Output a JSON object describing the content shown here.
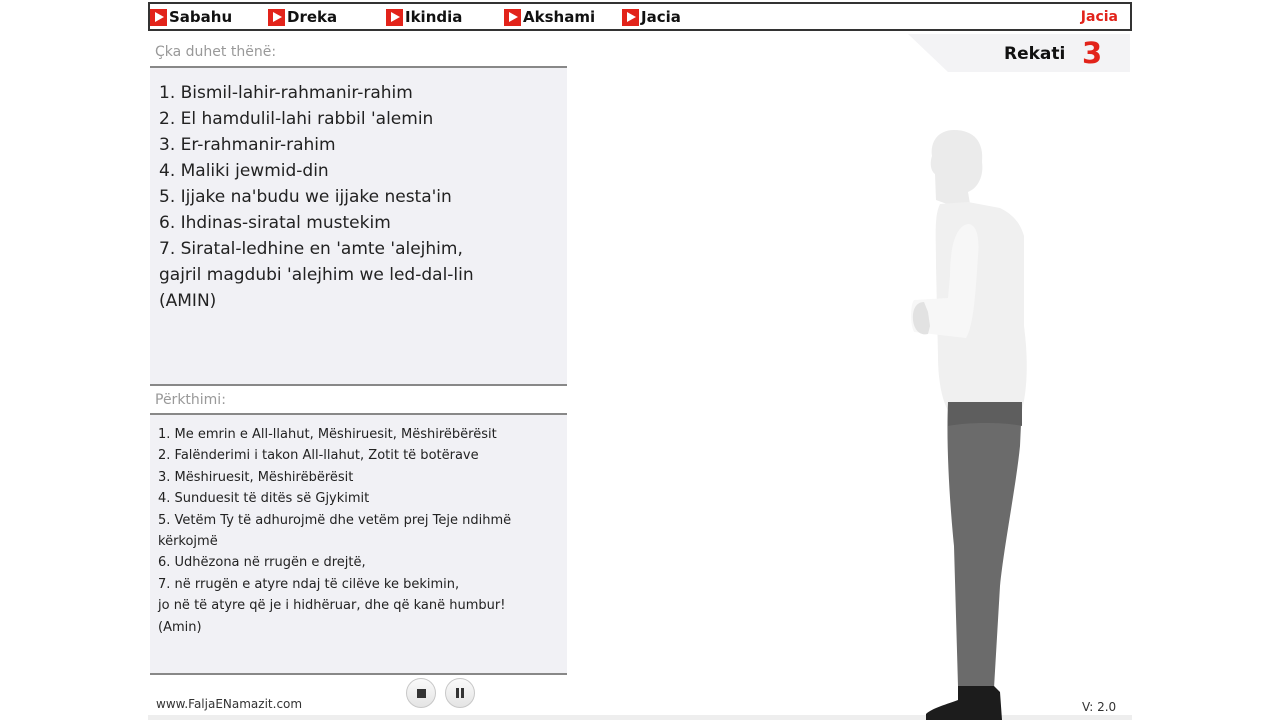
{
  "nav": {
    "items": [
      {
        "label": "Sabahu",
        "icon": "play-icon"
      },
      {
        "label": "Dreka",
        "icon": "play-icon"
      },
      {
        "label": "Ikindia",
        "icon": "play-icon"
      },
      {
        "label": "Akshami",
        "icon": "play-icon"
      },
      {
        "label": "Jacia",
        "icon": "play-icon"
      }
    ],
    "current": "Jacia"
  },
  "recite": {
    "label": "Çka duhet thënë:",
    "lines": [
      "1. Bismil-lahir-rahmanir-rahim",
      "2. El hamdulil-lahi rabbil 'alemin",
      "3. Er-rahmanir-rahim",
      "4. Maliki jewmid-din",
      "5. Ijjake na'budu we ijjake nesta'in",
      "6. Ihdinas-siratal mustekim",
      "7. Siratal-ledhine en 'amte 'alejhim,\ngajril magdubi 'alejhim we led-dal-lin\n(AMIN)"
    ]
  },
  "translation": {
    "label": "Përkthimi:",
    "lines": [
      "1. Me emrin e All-llahut, Mëshiruesit, Mëshirëbërësit",
      "2. Falënderimi i takon All-llahut, Zotit të botërave",
      "3. Mëshiruesit, Mëshirëbërësit",
      "4. Sunduesit të ditës së Gjykimit",
      "5. Vetëm Ty të adhurojmë dhe vetëm prej Teje ndihmë\nkërkojmë",
      "6. Udhëzona në rrugën e drejtë,",
      "7. në rrugën e atyre ndaj të cilëve ke bekimin,\njo në të atyre që je i hidhëruar, dhe që kanë humbur!\n  (Amin)"
    ]
  },
  "rakat": {
    "label": "Rekati",
    "number": "3"
  },
  "footer": {
    "url": "www.FaljaENamazit.com",
    "version": "V: 2.0"
  },
  "controls": {
    "stop_icon": "stop-icon",
    "pause_icon": "pause-icon"
  },
  "colors": {
    "accent": "#e2231a",
    "panel": "#f1f1f5",
    "shirt": "#f0f0f0",
    "pants": "#6b6b6b"
  }
}
